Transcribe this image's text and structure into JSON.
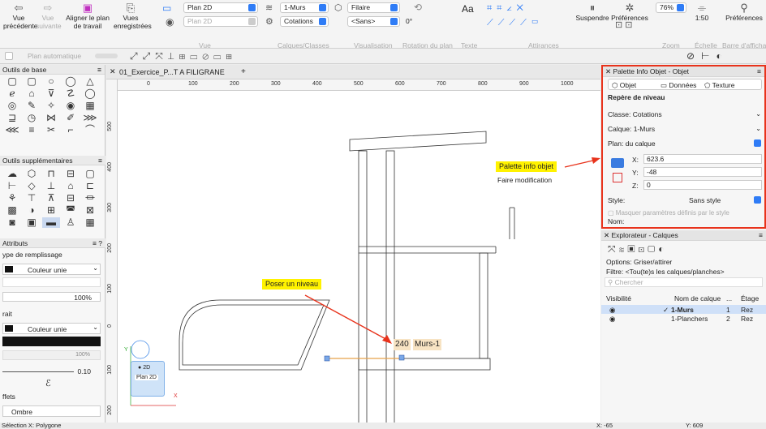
{
  "toolbar": {
    "prev_view": "Vue précédente",
    "next_view": "Vue suivante",
    "align_plan": "Aligner le plan de travail",
    "saved_views": "Vues enregistrées",
    "views_group": "Vue",
    "view_plan": "Plan 2D",
    "view_plan2": "Plan 2D",
    "layer": "1-Murs",
    "class": "Cotations",
    "group_layers": "Calques/Classes",
    "render_wire": "Filaire",
    "render_sans": "<Sans>",
    "rotation_value": "0°",
    "group_visualisation": "Visualisation",
    "group_rotation": "Rotation du plan",
    "text_label": "Aa",
    "group_text": "Texte",
    "group_snaps": "Attirances",
    "suspend": "Suspendre",
    "preferences": "Préférences",
    "zoom_value": "76%",
    "group_zoom": "Zoom",
    "scale_value": "1:50",
    "group_scale": "Échelle",
    "preferences2": "Préférences",
    "group_barre": "Barre d'affichage"
  },
  "toolbar2": {
    "auto_plan": "Plan automatique"
  },
  "left_panel": {
    "basic_tools_title": "Outils de base",
    "extra_tools_title": "Outils supplémentaires",
    "attributes_title": "Attributs",
    "fill_type_label": "ype de remplissage",
    "fill_value": "Couleur unie",
    "opacity_value": "100%",
    "stroke_label": "rait",
    "stroke_value": "Couleur unie",
    "line_weight": "0.10",
    "effects_label": "ffets",
    "shadow_label": "Ombre",
    "opacity_badge": "100%"
  },
  "document": {
    "tab_title": "01_Exercice_P...T A FILIGRANE",
    "add_tab": "+",
    "ruler_top": [
      "0",
      "100",
      "200",
      "300",
      "400",
      "500",
      "600",
      "700",
      "800",
      "900",
      "1000"
    ],
    "ruler_left": [
      "500",
      "400",
      "300",
      "200",
      "100",
      "0",
      "100",
      "200"
    ],
    "callout_palette": "Palette info objet",
    "callout_sub": "Faire modification",
    "callout_level": "Poser un niveau",
    "level_value": "240",
    "level_layer": "Murs-1",
    "plan_badge_1": "2D",
    "plan_badge_2": "Plan 2D",
    "axis_y": "Y",
    "axis_x": "X"
  },
  "obj_palette": {
    "title": "Palette Info Objet - Objet",
    "tab_object": "Objet",
    "tab_data": "Données",
    "tab_texture": "Texture",
    "section": "Repère de niveau",
    "class_label": "Classe:",
    "class_value": "Cotations",
    "layer_label": "Calque:",
    "layer_value": "1-Murs",
    "plan_label": "Plan:",
    "plan_value": "du calque",
    "x_label": "X:",
    "x_value": "623.6",
    "y_label": "Y:",
    "y_value": "-48",
    "z_label": "Z:",
    "z_value": "0",
    "style_label": "Style:",
    "style_value": "Sans style",
    "mask_label": "Masquer paramètres définis par le style",
    "name_label": "Nom:"
  },
  "layers_palette": {
    "title": "Explorateur - Calques",
    "options_label": "Options:",
    "options_value": "Griser/attirer",
    "filter_label": "Filtre:",
    "filter_value": "<Tou(te)s les calques/planches>",
    "search_placeholder": "Chercher",
    "col_visibility": "Visibilité",
    "col_name": "Nom de calque",
    "col_dots": "...",
    "col_floor": "Étage",
    "rows": [
      {
        "check": "✓",
        "name": "1-Murs",
        "num": "1",
        "floor": "Rez"
      },
      {
        "check": "",
        "name": "1-Planchers",
        "num": "2",
        "floor": "Rez"
      }
    ]
  },
  "status": {
    "left": "Sélection  X: Polygone",
    "x": "X: -65",
    "y": "Y: 609"
  },
  "colors": {
    "accent": "#2f7cf6",
    "callout_bg": "#fff200",
    "arrow": "#e8331c",
    "highlight_border": "#e8331c",
    "level_line": "#e8a24a"
  }
}
